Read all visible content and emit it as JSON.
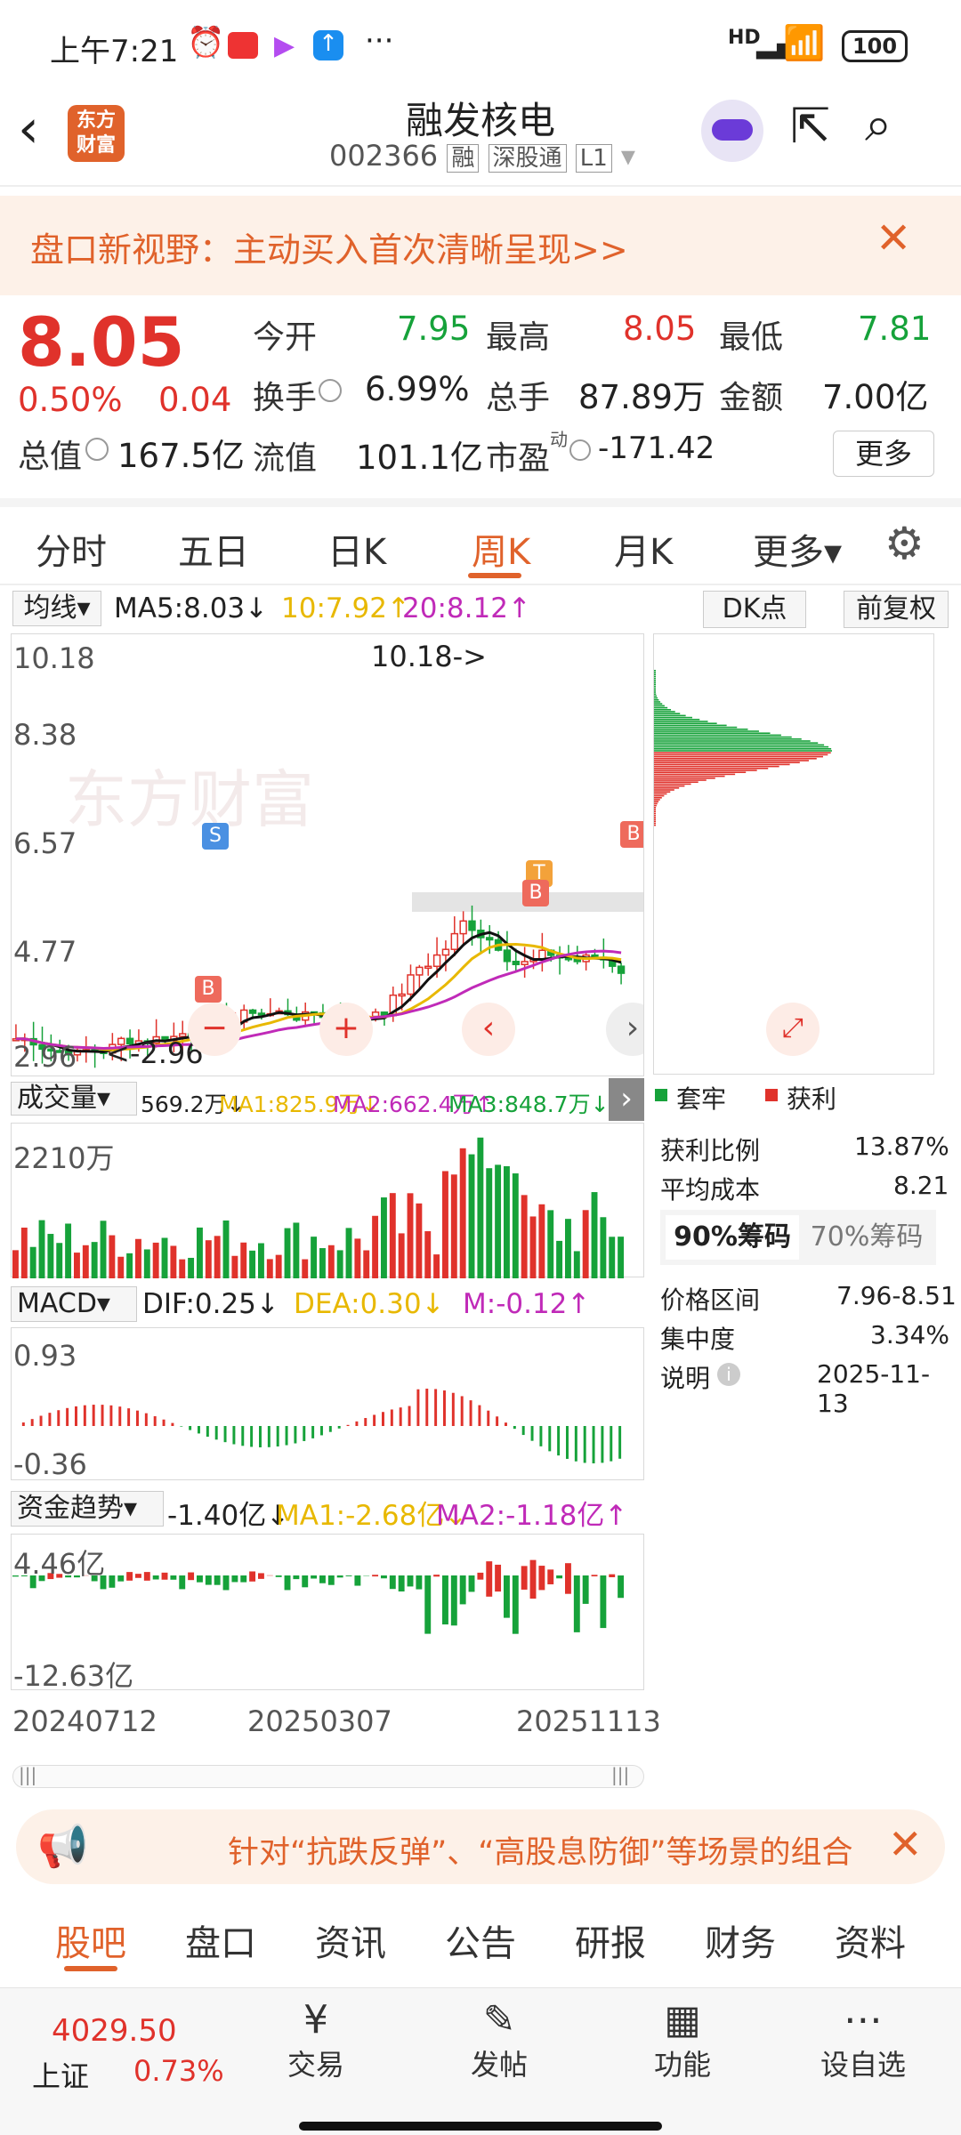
{
  "status_bar": {
    "time": "上午7:21",
    "battery": "100",
    "hd": "HD"
  },
  "header": {
    "title": "融发核电",
    "code": "002366",
    "tags": [
      "融",
      "深股通",
      "L1"
    ],
    "logo_text": [
      "东方",
      "财富"
    ]
  },
  "banner": {
    "text": "盘口新视野：主动买入首次清晰呈现>>"
  },
  "quote": {
    "price": "8.05",
    "change_pct": "0.50%",
    "change": "0.04",
    "open_label": "今开",
    "open": "7.95",
    "high_label": "最高",
    "high": "8.05",
    "low_label": "最低",
    "low": "7.81",
    "turnover_label": "换手",
    "turnover": "6.99%",
    "volume_label": "总手",
    "volume": "87.89万",
    "amount_label": "金额",
    "amount": "7.00亿",
    "mktcap_label": "总值",
    "mktcap": "167.5亿",
    "float_label": "流值",
    "float": "101.1亿",
    "pe_label": "市盈",
    "pe_sup": "动",
    "pe": "-171.42",
    "more": "更多"
  },
  "tabs": [
    "分时",
    "五日",
    "日K",
    "周K",
    "月K",
    "更多▾"
  ],
  "active_tab": 3,
  "kline": {
    "ma_selector": "均线▾",
    "ma5": "MA5:8.03↓",
    "ma10": "10:7.92↑",
    "ma20": "20:8.12↑",
    "dk": "DK点",
    "fq": "前复权",
    "y_labels": [
      "10.18",
      "8.38",
      "6.57",
      "4.77",
      "2.96"
    ],
    "max_label": "10.18->",
    "min_label": "<-2.96"
  },
  "chips": {
    "legend_trap": "套牢",
    "legend_profit": "获利",
    "profit_ratio_label": "获利比例",
    "profit_ratio": "13.87%",
    "avg_cost_label": "平均成本",
    "avg_cost": "8.21",
    "tab90": "90%筹码",
    "tab70": "70%筹码",
    "range_label": "价格区间",
    "range": "7.96-8.51",
    "concentration_label": "集中度",
    "concentration": "3.34%",
    "note_label": "说明",
    "note_date": "2025-11-13"
  },
  "volume": {
    "selector": "成交量▾",
    "vol": "569.2万↓",
    "ma1": "MA1:825.9万↓",
    "ma2": "MA2:662.4万↑",
    "ma3": "MA3:848.7万↓",
    "y_max": "2210万"
  },
  "macd": {
    "selector": "MACD▾",
    "dif": "DIF:0.25↓",
    "dea": "DEA:0.30↓",
    "m": "M:-0.12↑",
    "y_max": "0.93",
    "y_min": "-0.36"
  },
  "capital": {
    "selector": "资金趋势▾",
    "val": "-1.40亿↓",
    "ma1": "MA1:-2.68亿↓",
    "ma2": "MA2:-1.18亿↑",
    "y_max": "4.46亿",
    "y_min": "-12.63亿"
  },
  "dates": [
    "20240712",
    "20250307",
    "20251113"
  ],
  "promo": {
    "text": "针对“抗跌反弹”、“高股息防御”等场景的组合"
  },
  "bottom_tabs": [
    "股吧",
    "盘口",
    "资讯",
    "公告",
    "研报",
    "财务",
    "资料"
  ],
  "index": {
    "value": "4029.50",
    "name": "上证",
    "pct": "0.73%"
  },
  "nav": [
    "交易",
    "发帖",
    "功能",
    "设自选"
  ],
  "colors": {
    "up": "#e0322b",
    "down": "#16a23a",
    "accent": "#e0622b"
  }
}
